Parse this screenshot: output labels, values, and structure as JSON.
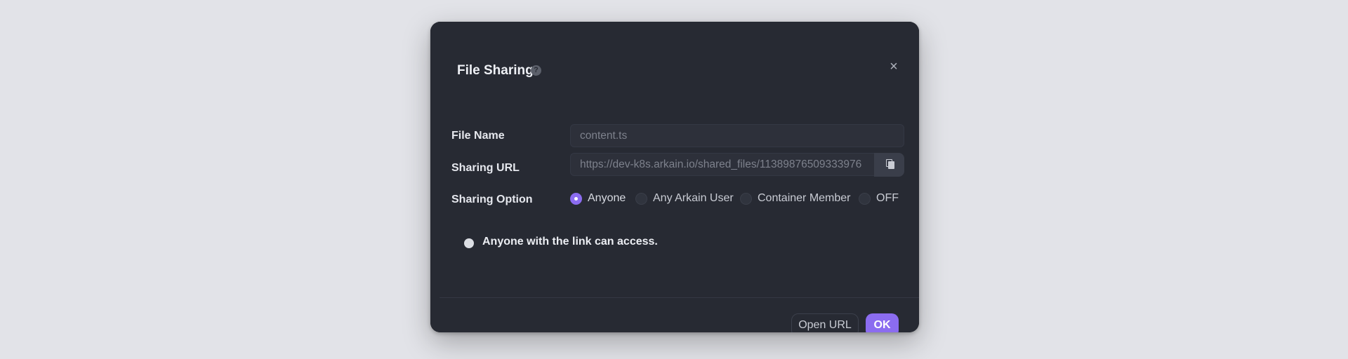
{
  "dialog": {
    "title": "File Sharing",
    "help_icon": "question-circle-icon",
    "close_icon": "×"
  },
  "form": {
    "file_name_label": "File Name",
    "file_name_value": "content.ts",
    "sharing_url_label": "Sharing URL",
    "sharing_url_value": "https://dev-k8s.arkain.io/shared_files/11389876509333976",
    "copy_icon": "copy-icon",
    "sharing_option_label": "Sharing Option",
    "sharing_options": [
      {
        "label": "Anyone",
        "selected": true
      },
      {
        "label": "Any Arkain User",
        "selected": false
      },
      {
        "label": "Container Member",
        "selected": false
      },
      {
        "label": "OFF",
        "selected": false
      }
    ],
    "info_text": "Anyone with the link can access."
  },
  "footer": {
    "open_url_label": "Open URL",
    "ok_label": "OK"
  },
  "colors": {
    "accent": "#8b6cf0",
    "dialog_bg": "#272a33",
    "page_bg": "#e2e3e8"
  }
}
